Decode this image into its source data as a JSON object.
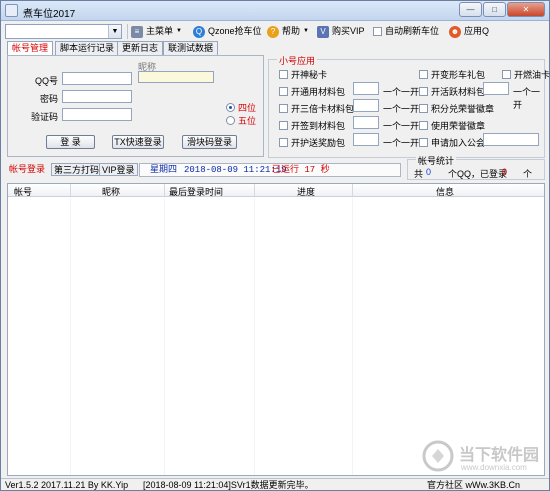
{
  "window": {
    "title": "煮车位2017"
  },
  "toolbar": {
    "combo_value": "",
    "main_menu": "主菜单",
    "qzone": "Qzone抢车位",
    "help": "帮助",
    "buy_vip": "购买VIP",
    "auto_refresh": "自动刷新车位",
    "app_q": "应用Q"
  },
  "tabs": [
    "帐号管理",
    "脚本运行记录",
    "更新日志",
    "联测试数据"
  ],
  "login": {
    "qq_label": "QQ号",
    "pwd_label": "密码",
    "captcha_label": "验证码",
    "nickname_label": "昵称",
    "login_btn": "登 录",
    "tx_btn": "TX快速登录",
    "slider_btn": "滑块码登录",
    "four": "四位",
    "five": "五位"
  },
  "group": {
    "title": "小号应用",
    "items": [
      "开神秘卡",
      "开通用材料包",
      "开三倍卡材料包",
      "开签到材料包",
      "开护送奖励包"
    ],
    "right_items": [
      "开变形车礼包",
      "开燃油卡",
      "开活跃材料包",
      "积分兑荣誉徽章",
      "使用荣誉徽章",
      "申请加入公会"
    ],
    "unit": "一个一开"
  },
  "subtabs": [
    "帐号登录",
    "第三方打码",
    "VIP登录"
  ],
  "info": {
    "day": "星期四",
    "datetime": "2018-08-09 11:21:19",
    "running": "已运行 17 秒"
  },
  "stats": {
    "title": "帐号统计",
    "prefix": "共",
    "total": "0",
    "mid": "个QQ，已登录",
    "logged": "0",
    "suffix": "个"
  },
  "table": {
    "headers": [
      "帐号",
      "昵称",
      "最后登录时间",
      "进度",
      "信息"
    ]
  },
  "status": {
    "version": "Ver1.5.2 2017.11.21 By KK.Yip",
    "log": "[2018-08-09 11:21:04]SVr1数据更新完毕。",
    "community": "官方社区 wWw.3KB.Cn"
  },
  "watermark": {
    "line1": "当下软件园",
    "line2": "www.downxia.com"
  },
  "colors": {
    "accent_red": "#d40000",
    "info_blue": "#0a2aa8"
  }
}
